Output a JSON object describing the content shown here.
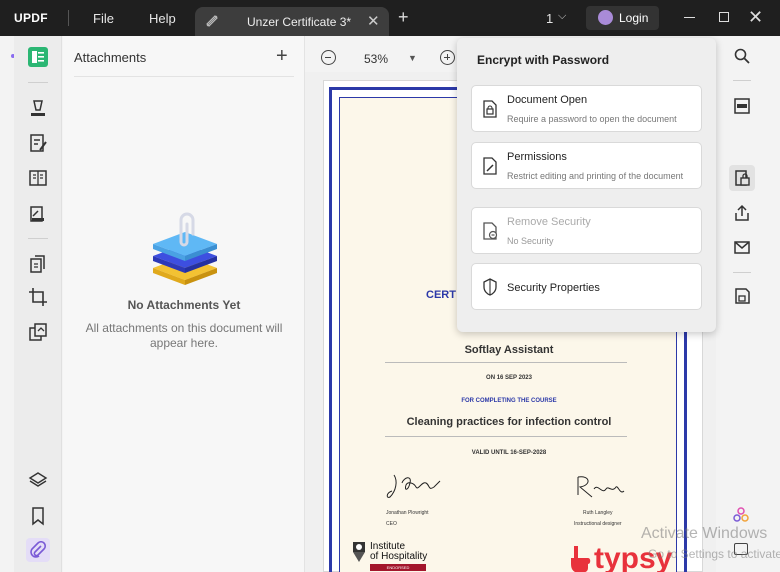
{
  "app": {
    "logo": "UPDF"
  },
  "menu": {
    "file": "File",
    "help": "Help"
  },
  "tab": {
    "title": "Unzer Certificate 3*",
    "close": "✕",
    "add": "+"
  },
  "header": {
    "page_count": "1",
    "chevron": "⌵",
    "login": "Login",
    "close_window": "✕"
  },
  "attachments": {
    "title": "Attachments",
    "add": "+",
    "empty_title": "No Attachments Yet",
    "empty_desc": "All attachments on this document will appear here."
  },
  "zoom": {
    "value": "53%",
    "chevron": "▼"
  },
  "certificate": {
    "heading": "CERT",
    "recipient": "Softlay Assistant",
    "date": "ON 16 SEP 2023",
    "for": "FOR COMPLETING THE COURSE",
    "course": "Cleaning practices for infection control",
    "valid": "VALID UNTIL 16-SEP-2028",
    "signer1_name": "Jonathan Plowright",
    "signer1_title": "CEO",
    "signer2_name": "Ruth Langley",
    "signer2_title": "Instructional designer",
    "logo1_line1": "Institute",
    "logo1_line2": "of Hospitality",
    "logo1_badge": "ENDORSED",
    "logo2": "typsy"
  },
  "encrypt": {
    "title": "Encrypt with Password",
    "options": [
      {
        "label": "Document Open",
        "desc": "Require a password to open the document",
        "enabled": true
      },
      {
        "label": "Permissions",
        "desc": "Restrict editing and printing of the document",
        "enabled": true
      },
      {
        "label": "Remove Security",
        "desc": "No Security",
        "enabled": false
      },
      {
        "label": "Security Properties",
        "desc": "",
        "enabled": true
      }
    ]
  },
  "watermark": {
    "line1": "Activate Windows",
    "line2": "Go to Settings to activate"
  },
  "colors": {
    "accent": "#2c39a8",
    "brand_green": "#2bb673",
    "typsy_red": "#e8323c",
    "titlebar": "#1f1f1f"
  },
  "icons": {
    "left_rail": [
      "read-icon",
      "highlight-icon",
      "edit-text-icon",
      "page-view-icon",
      "fill-sign-icon",
      "organize-pages-icon",
      "crop-icon",
      "convert-icon",
      "layers-icon",
      "bookmark-icon",
      "attachment-icon"
    ],
    "right_rail": [
      "search-icon",
      "ocr-icon",
      "protect-icon",
      "share-icon",
      "email-icon",
      "save-icon",
      "ai-icon",
      "chat-icon"
    ]
  }
}
